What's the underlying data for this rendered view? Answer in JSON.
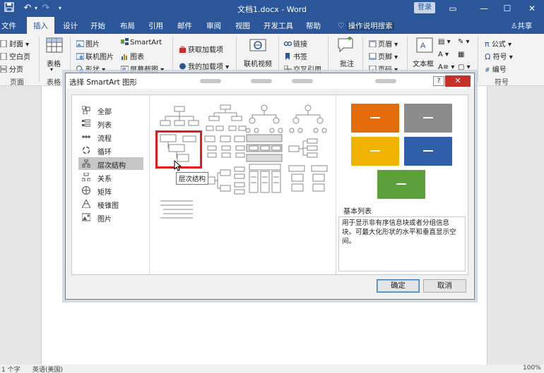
{
  "titlebar": {
    "doc_title": "文档1.docx - Word",
    "login": "登录",
    "save_icon": "save-icon",
    "undo_icon": "undo-icon",
    "redo_icon": "redo-icon"
  },
  "tabs": [
    {
      "label": "文件"
    },
    {
      "label": "插入"
    },
    {
      "label": "设计"
    },
    {
      "label": "开始"
    },
    {
      "label": "布局"
    },
    {
      "label": "引用"
    },
    {
      "label": "邮件"
    },
    {
      "label": "审阅"
    },
    {
      "label": "视图"
    },
    {
      "label": "开发工具"
    },
    {
      "label": "帮助"
    }
  ],
  "tell_me": "操作说明搜索",
  "share": "共享",
  "ribbon": {
    "pages": {
      "cover": "封面",
      "blank": "空白页",
      "break": "分页",
      "label": "页面"
    },
    "table": {
      "btn": "表格",
      "label": "表格"
    },
    "illustrations": {
      "picture": "图片",
      "online_picture": "联机图片",
      "shapes": "形状",
      "smartart": "SmartArt",
      "chart": "图表",
      "screenshot": "屏幕截图"
    },
    "addins": {
      "get": "获取加载项",
      "my": "我的加载项"
    },
    "media": {
      "online_video": "联机视频"
    },
    "links": {
      "link": "链接",
      "bookmark": "书签",
      "cross_ref": "交叉引用"
    },
    "comments": {
      "comment": "批注"
    },
    "header_footer": {
      "header": "页眉",
      "footer": "页脚",
      "page_number": "页码"
    },
    "text": {
      "textbox": "文本框"
    },
    "symbols": {
      "equation": "公式",
      "symbol": "符号",
      "numbering": "编号",
      "label": "符号"
    }
  },
  "dialog": {
    "title": "选择 SmartArt 图形",
    "help": "?",
    "close": "✕",
    "categories": [
      {
        "label": "全部",
        "icon": "all-icon"
      },
      {
        "label": "列表",
        "icon": "list-icon"
      },
      {
        "label": "流程",
        "icon": "process-icon"
      },
      {
        "label": "循环",
        "icon": "cycle-icon"
      },
      {
        "label": "层次结构",
        "icon": "hierarchy-icon"
      },
      {
        "label": "关系",
        "icon": "relationship-icon"
      },
      {
        "label": "矩阵",
        "icon": "matrix-icon"
      },
      {
        "label": "棱锥图",
        "icon": "pyramid-icon"
      },
      {
        "label": "图片",
        "icon": "picture-icon"
      }
    ],
    "selected_category": "层次结构",
    "tooltip": "层次结构",
    "preview_title": "基本列表",
    "preview_desc": "用于显示非有序信息块或者分组信息块。可最大化形状的水平和垂直显示空间。",
    "ok": "确定",
    "cancel": "取消",
    "preview_colors": {
      "orange": "#e46c0a",
      "gray": "#8c8c8c",
      "yellow": "#f0b400",
      "blue": "#2e5fa8",
      "green": "#5ba03a"
    }
  },
  "status": {
    "words": "1 个字",
    "language": "英语(美国)",
    "zoom": "100%"
  }
}
